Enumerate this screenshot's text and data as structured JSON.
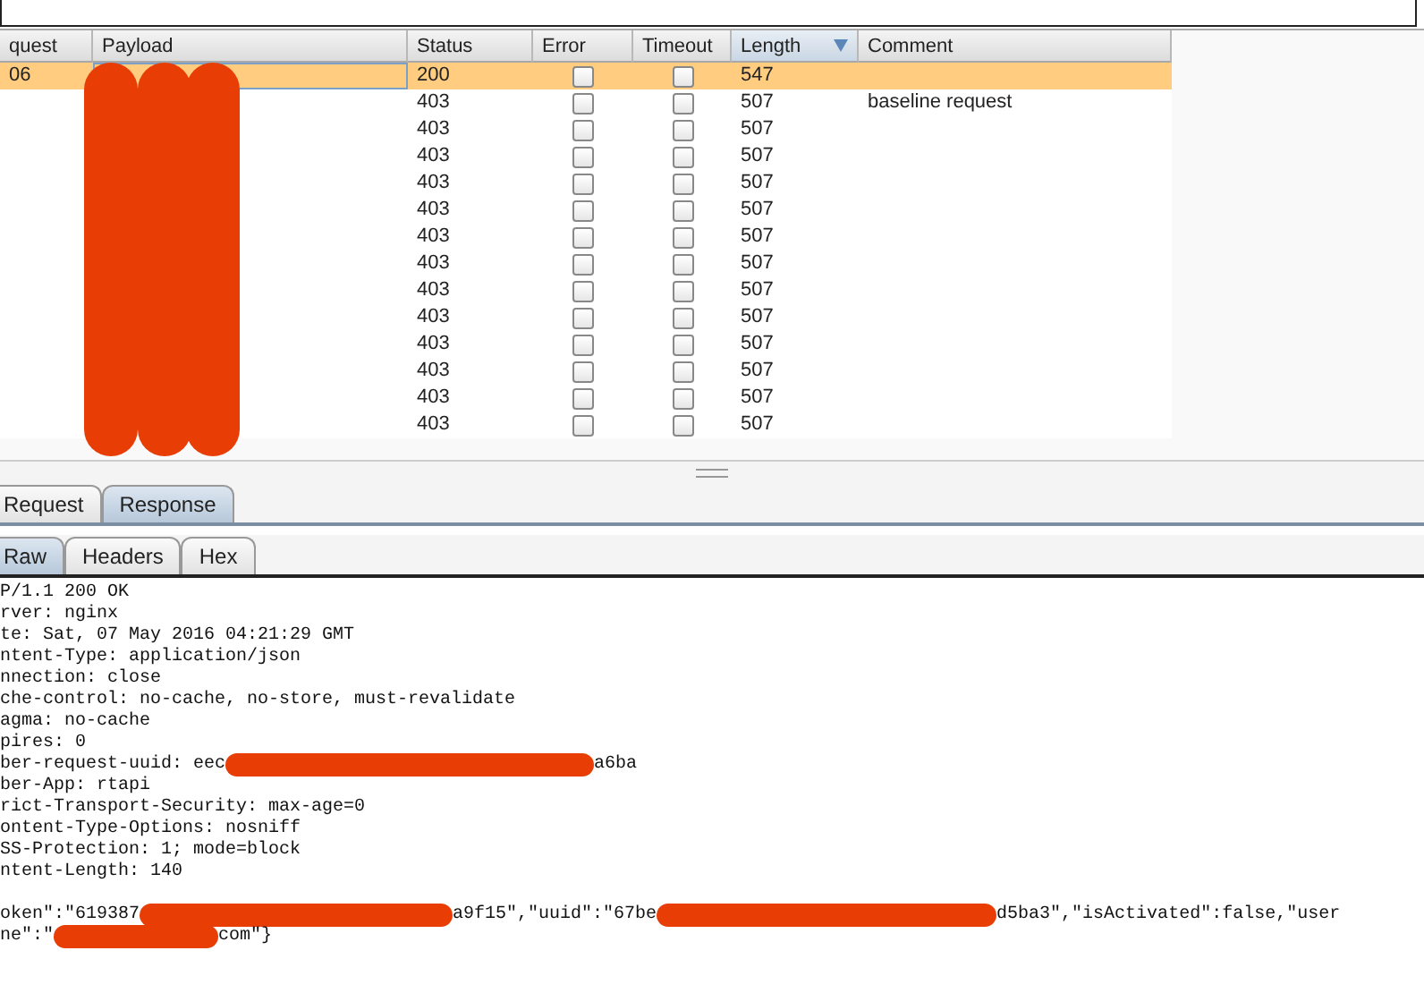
{
  "table": {
    "columns": [
      {
        "label": "quest",
        "sorted": false
      },
      {
        "label": "Payload",
        "sorted": false
      },
      {
        "label": "Status",
        "sorted": false
      },
      {
        "label": "Error",
        "sorted": false
      },
      {
        "label": "Timeout",
        "sorted": false
      },
      {
        "label": "Length",
        "sorted": true
      },
      {
        "label": "Comment",
        "sorted": false
      }
    ],
    "rows": [
      {
        "request": "06",
        "status": "200",
        "error": false,
        "timeout": false,
        "length": "547",
        "comment": "",
        "selected": true
      },
      {
        "request": "",
        "status": "403",
        "error": false,
        "timeout": false,
        "length": "507",
        "comment": "baseline request",
        "selected": false
      },
      {
        "request": "",
        "status": "403",
        "error": false,
        "timeout": false,
        "length": "507",
        "comment": "",
        "selected": false
      },
      {
        "request": "",
        "status": "403",
        "error": false,
        "timeout": false,
        "length": "507",
        "comment": "",
        "selected": false
      },
      {
        "request": "",
        "status": "403",
        "error": false,
        "timeout": false,
        "length": "507",
        "comment": "",
        "selected": false
      },
      {
        "request": "",
        "status": "403",
        "error": false,
        "timeout": false,
        "length": "507",
        "comment": "",
        "selected": false
      },
      {
        "request": "",
        "status": "403",
        "error": false,
        "timeout": false,
        "length": "507",
        "comment": "",
        "selected": false
      },
      {
        "request": "",
        "status": "403",
        "error": false,
        "timeout": false,
        "length": "507",
        "comment": "",
        "selected": false
      },
      {
        "request": "",
        "status": "403",
        "error": false,
        "timeout": false,
        "length": "507",
        "comment": "",
        "selected": false
      },
      {
        "request": "",
        "status": "403",
        "error": false,
        "timeout": false,
        "length": "507",
        "comment": "",
        "selected": false
      },
      {
        "request": "",
        "status": "403",
        "error": false,
        "timeout": false,
        "length": "507",
        "comment": "",
        "selected": false
      },
      {
        "request": "",
        "status": "403",
        "error": false,
        "timeout": false,
        "length": "507",
        "comment": "",
        "selected": false
      },
      {
        "request": "",
        "status": "403",
        "error": false,
        "timeout": false,
        "length": "507",
        "comment": "",
        "selected": false
      },
      {
        "request": "",
        "status": "403",
        "error": false,
        "timeout": false,
        "length": "507",
        "comment": "",
        "selected": false
      }
    ]
  },
  "message_tabs": [
    {
      "label": "Request",
      "selected": false
    },
    {
      "label": "Response",
      "selected": true
    }
  ],
  "view_tabs": [
    {
      "label": "Raw",
      "selected": true
    },
    {
      "label": "Headers",
      "selected": false
    },
    {
      "label": "Hex",
      "selected": false
    }
  ],
  "response_lines": [
    {
      "spaced": false,
      "parts": [
        {
          "kind": "text",
          "text": "P/1.1 200 OK"
        }
      ]
    },
    {
      "spaced": false,
      "parts": [
        {
          "kind": "text",
          "text": "rver: nginx"
        }
      ]
    },
    {
      "spaced": false,
      "parts": [
        {
          "kind": "text",
          "text": "te: Sat, 07 May 2016 04:21:29 GMT"
        }
      ]
    },
    {
      "spaced": false,
      "parts": [
        {
          "kind": "text",
          "text": "ntent-Type: application/json"
        }
      ]
    },
    {
      "spaced": false,
      "parts": [
        {
          "kind": "text",
          "text": "nnection: close"
        }
      ]
    },
    {
      "spaced": false,
      "parts": [
        {
          "kind": "text",
          "text": "che-control: no-cache, no-store, must-revalidate"
        }
      ]
    },
    {
      "spaced": false,
      "parts": [
        {
          "kind": "text",
          "text": "agma: no-cache"
        }
      ]
    },
    {
      "spaced": false,
      "parts": [
        {
          "kind": "text",
          "text": "pires: 0"
        }
      ]
    },
    {
      "spaced": false,
      "parts": [
        {
          "kind": "text",
          "text": "ber-request-uuid: eec"
        },
        {
          "kind": "redacted"
        },
        {
          "kind": "text",
          "text": "a6ba"
        }
      ]
    },
    {
      "spaced": false,
      "parts": [
        {
          "kind": "text",
          "text": "ber-App: rtapi"
        }
      ]
    },
    {
      "spaced": false,
      "parts": [
        {
          "kind": "text",
          "text": "rict-Transport-Security: max-age=0"
        }
      ]
    },
    {
      "spaced": false,
      "parts": [
        {
          "kind": "text",
          "text": "ontent-Type-Options: nosniff"
        }
      ]
    },
    {
      "spaced": false,
      "parts": [
        {
          "kind": "text",
          "text": "SS-Protection: 1; mode=block"
        }
      ]
    },
    {
      "spaced": false,
      "parts": [
        {
          "kind": "text",
          "text": "ntent-Length: 140"
        }
      ]
    },
    {
      "spaced": true,
      "parts": [
        {
          "kind": "text",
          "text": "oken\":\"619387"
        },
        {
          "kind": "redacted"
        },
        {
          "kind": "text",
          "text": "a9f15\",\"uuid\":\"67be"
        },
        {
          "kind": "redacted"
        },
        {
          "kind": "text",
          "text": "d5ba3\",\"isActivated\":false,\"user"
        }
      ]
    },
    {
      "spaced": false,
      "parts": [
        {
          "kind": "text",
          "text": "ne\":\""
        },
        {
          "kind": "redacted"
        },
        {
          "kind": "text",
          "text": "com\"}"
        }
      ]
    }
  ]
}
